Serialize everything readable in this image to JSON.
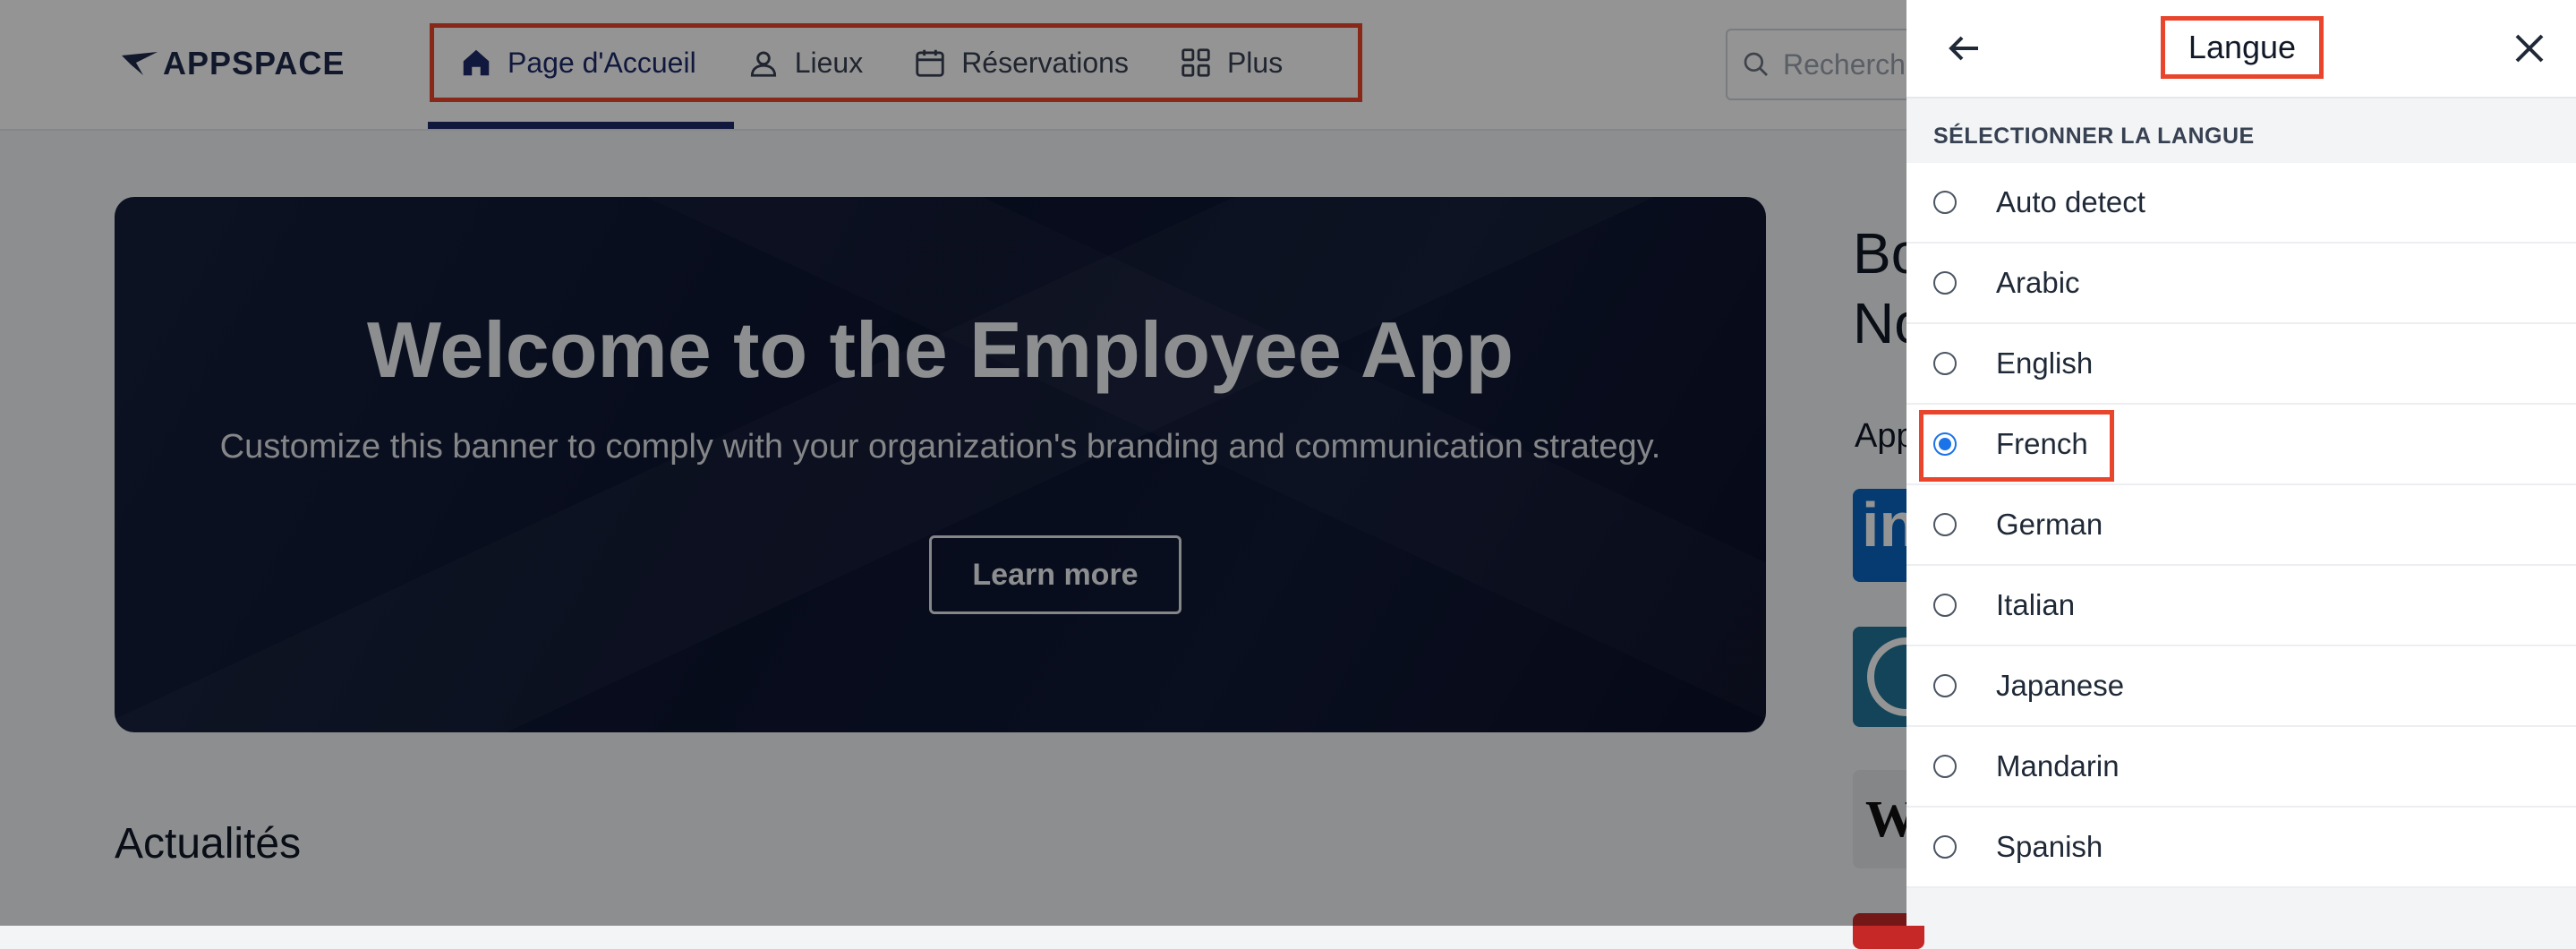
{
  "header": {
    "logo_text": "APPSPACE",
    "nav": [
      {
        "label": "Page d'Accueil",
        "icon": "home-icon"
      },
      {
        "label": "Lieux",
        "icon": "location-person-icon"
      },
      {
        "label": "Réservations",
        "icon": "calendar-icon"
      },
      {
        "label": "Plus",
        "icon": "grid-icon"
      }
    ],
    "search_placeholder": "Recherche"
  },
  "banner": {
    "title": "Welcome to the Employee App",
    "subtitle": "Customize this banner to comply with your organization's branding and communication strategy.",
    "button_label": "Learn more"
  },
  "news": {
    "title": "Actualités"
  },
  "side": {
    "heading_line1": "Bo",
    "heading_line2": "No",
    "apps_label": "App",
    "tile_linkedin": "in",
    "tile_wsj": "WS"
  },
  "panel": {
    "title": "Langue",
    "section_label": "SÉLECTIONNER LA LANGUE",
    "languages": [
      "Auto detect",
      "Arabic",
      "English",
      "French",
      "German",
      "Italian",
      "Japanese",
      "Mandarin",
      "Spanish"
    ],
    "selected": "French"
  },
  "colors": {
    "accent": "#1e2a6a",
    "highlight": "#e8452c",
    "radio": "#1a73e8"
  }
}
